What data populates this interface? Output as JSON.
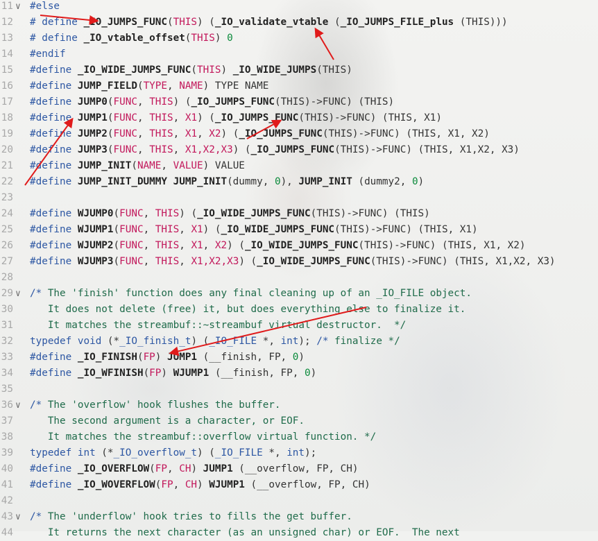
{
  "editor": {
    "lines": [
      {
        "n": "11",
        "fold": true,
        "tokens": [
          {
            "t": "k",
            "v": "#else"
          }
        ]
      },
      {
        "n": "12",
        "tokens": [
          {
            "t": "k",
            "v": "# define "
          },
          {
            "t": "b",
            "v": "_IO_JUMPS_FUNC"
          },
          {
            "t": "p",
            "v": "("
          },
          {
            "t": "s",
            "v": "THIS"
          },
          {
            "t": "p",
            "v": ") ("
          },
          {
            "t": "b",
            "v": "_IO_validate_vtable"
          },
          {
            "t": "p",
            "v": " ("
          },
          {
            "t": "b",
            "v": "_IO_JUMPS_FILE_plus"
          },
          {
            "t": "p",
            "v": " (THIS)))"
          }
        ]
      },
      {
        "n": "13",
        "tokens": [
          {
            "t": "k",
            "v": "# define "
          },
          {
            "t": "b",
            "v": "_IO_vtable_offset"
          },
          {
            "t": "p",
            "v": "("
          },
          {
            "t": "s",
            "v": "THIS"
          },
          {
            "t": "p",
            "v": ") "
          },
          {
            "t": "n",
            "v": "0"
          }
        ]
      },
      {
        "n": "14",
        "tokens": [
          {
            "t": "k",
            "v": "#endif"
          }
        ]
      },
      {
        "n": "15",
        "tokens": [
          {
            "t": "k",
            "v": "#define "
          },
          {
            "t": "b",
            "v": "_IO_WIDE_JUMPS_FUNC"
          },
          {
            "t": "p",
            "v": "("
          },
          {
            "t": "s",
            "v": "THIS"
          },
          {
            "t": "p",
            "v": ") "
          },
          {
            "t": "b",
            "v": "_IO_WIDE_JUMPS"
          },
          {
            "t": "p",
            "v": "(THIS)"
          }
        ]
      },
      {
        "n": "16",
        "tokens": [
          {
            "t": "k",
            "v": "#define "
          },
          {
            "t": "b",
            "v": "JUMP_FIELD"
          },
          {
            "t": "p",
            "v": "("
          },
          {
            "t": "s",
            "v": "TYPE"
          },
          {
            "t": "p",
            "v": ", "
          },
          {
            "t": "s",
            "v": "NAME"
          },
          {
            "t": "p",
            "v": ") TYPE NAME"
          }
        ]
      },
      {
        "n": "17",
        "tokens": [
          {
            "t": "k",
            "v": "#define "
          },
          {
            "t": "b",
            "v": "JUMP0"
          },
          {
            "t": "p",
            "v": "("
          },
          {
            "t": "s",
            "v": "FUNC"
          },
          {
            "t": "p",
            "v": ", "
          },
          {
            "t": "s",
            "v": "THIS"
          },
          {
            "t": "p",
            "v": ") ("
          },
          {
            "t": "b",
            "v": "_IO_JUMPS_FUNC"
          },
          {
            "t": "p",
            "v": "(THIS)->FUNC) (THIS)"
          }
        ]
      },
      {
        "n": "18",
        "tokens": [
          {
            "t": "k",
            "v": "#define "
          },
          {
            "t": "b",
            "v": "JUMP1"
          },
          {
            "t": "p",
            "v": "("
          },
          {
            "t": "s",
            "v": "FUNC"
          },
          {
            "t": "p",
            "v": ", "
          },
          {
            "t": "s",
            "v": "THIS"
          },
          {
            "t": "p",
            "v": ", "
          },
          {
            "t": "s",
            "v": "X1"
          },
          {
            "t": "p",
            "v": ") ("
          },
          {
            "t": "b",
            "v": "_IO_JUMPS_FUNC"
          },
          {
            "t": "p",
            "v": "(THIS)->FUNC) (THIS, X1)"
          }
        ]
      },
      {
        "n": "19",
        "tokens": [
          {
            "t": "k",
            "v": "#define "
          },
          {
            "t": "b",
            "v": "JUMP2"
          },
          {
            "t": "p",
            "v": "("
          },
          {
            "t": "s",
            "v": "FUNC"
          },
          {
            "t": "p",
            "v": ", "
          },
          {
            "t": "s",
            "v": "THIS"
          },
          {
            "t": "p",
            "v": ", "
          },
          {
            "t": "s",
            "v": "X1"
          },
          {
            "t": "p",
            "v": ", "
          },
          {
            "t": "s",
            "v": "X2"
          },
          {
            "t": "p",
            "v": ") ("
          },
          {
            "t": "b",
            "v": "_IO_JUMPS_FUNC"
          },
          {
            "t": "p",
            "v": "(THIS)->FUNC) (THIS, X1, X2)"
          }
        ]
      },
      {
        "n": "20",
        "tokens": [
          {
            "t": "k",
            "v": "#define "
          },
          {
            "t": "b",
            "v": "JUMP3"
          },
          {
            "t": "p",
            "v": "("
          },
          {
            "t": "s",
            "v": "FUNC"
          },
          {
            "t": "p",
            "v": ", "
          },
          {
            "t": "s",
            "v": "THIS"
          },
          {
            "t": "p",
            "v": ", "
          },
          {
            "t": "s",
            "v": "X1,X2,X3"
          },
          {
            "t": "p",
            "v": ") ("
          },
          {
            "t": "b",
            "v": "_IO_JUMPS_FUNC"
          },
          {
            "t": "p",
            "v": "(THIS)->FUNC) (THIS, X1,X2, X3)"
          }
        ]
      },
      {
        "n": "21",
        "tokens": [
          {
            "t": "k",
            "v": "#define "
          },
          {
            "t": "b",
            "v": "JUMP_INIT"
          },
          {
            "t": "p",
            "v": "("
          },
          {
            "t": "s",
            "v": "NAME"
          },
          {
            "t": "p",
            "v": ", "
          },
          {
            "t": "s",
            "v": "VALUE"
          },
          {
            "t": "p",
            "v": ") VALUE"
          }
        ]
      },
      {
        "n": "22",
        "tokens": [
          {
            "t": "k",
            "v": "#define "
          },
          {
            "t": "b",
            "v": "JUMP_INIT_DUMMY"
          },
          {
            "t": "p",
            "v": " "
          },
          {
            "t": "b",
            "v": "JUMP_INIT"
          },
          {
            "t": "p",
            "v": "(dummy, "
          },
          {
            "t": "n",
            "v": "0"
          },
          {
            "t": "p",
            "v": "), "
          },
          {
            "t": "b",
            "v": "JUMP_INIT"
          },
          {
            "t": "p",
            "v": " (dummy2, "
          },
          {
            "t": "n",
            "v": "0"
          },
          {
            "t": "p",
            "v": ")"
          }
        ]
      },
      {
        "n": "23",
        "tokens": []
      },
      {
        "n": "24",
        "tokens": [
          {
            "t": "k",
            "v": "#define "
          },
          {
            "t": "b",
            "v": "WJUMP0"
          },
          {
            "t": "p",
            "v": "("
          },
          {
            "t": "s",
            "v": "FUNC"
          },
          {
            "t": "p",
            "v": ", "
          },
          {
            "t": "s",
            "v": "THIS"
          },
          {
            "t": "p",
            "v": ") ("
          },
          {
            "t": "b",
            "v": "_IO_WIDE_JUMPS_FUNC"
          },
          {
            "t": "p",
            "v": "(THIS)->FUNC) (THIS)"
          }
        ]
      },
      {
        "n": "25",
        "tokens": [
          {
            "t": "k",
            "v": "#define "
          },
          {
            "t": "b",
            "v": "WJUMP1"
          },
          {
            "t": "p",
            "v": "("
          },
          {
            "t": "s",
            "v": "FUNC"
          },
          {
            "t": "p",
            "v": ", "
          },
          {
            "t": "s",
            "v": "THIS"
          },
          {
            "t": "p",
            "v": ", "
          },
          {
            "t": "s",
            "v": "X1"
          },
          {
            "t": "p",
            "v": ") ("
          },
          {
            "t": "b",
            "v": "_IO_WIDE_JUMPS_FUNC"
          },
          {
            "t": "p",
            "v": "(THIS)->FUNC) (THIS, X1)"
          }
        ]
      },
      {
        "n": "26",
        "tokens": [
          {
            "t": "k",
            "v": "#define "
          },
          {
            "t": "b",
            "v": "WJUMP2"
          },
          {
            "t": "p",
            "v": "("
          },
          {
            "t": "s",
            "v": "FUNC"
          },
          {
            "t": "p",
            "v": ", "
          },
          {
            "t": "s",
            "v": "THIS"
          },
          {
            "t": "p",
            "v": ", "
          },
          {
            "t": "s",
            "v": "X1"
          },
          {
            "t": "p",
            "v": ", "
          },
          {
            "t": "s",
            "v": "X2"
          },
          {
            "t": "p",
            "v": ") ("
          },
          {
            "t": "b",
            "v": "_IO_WIDE_JUMPS_FUNC"
          },
          {
            "t": "p",
            "v": "(THIS)->FUNC) (THIS, X1, X2)"
          }
        ]
      },
      {
        "n": "27",
        "tokens": [
          {
            "t": "k",
            "v": "#define "
          },
          {
            "t": "b",
            "v": "WJUMP3"
          },
          {
            "t": "p",
            "v": "("
          },
          {
            "t": "s",
            "v": "FUNC"
          },
          {
            "t": "p",
            "v": ", "
          },
          {
            "t": "s",
            "v": "THIS"
          },
          {
            "t": "p",
            "v": ", "
          },
          {
            "t": "s",
            "v": "X1,X2,X3"
          },
          {
            "t": "p",
            "v": ") ("
          },
          {
            "t": "b",
            "v": "_IO_WIDE_JUMPS_FUNC"
          },
          {
            "t": "p",
            "v": "(THIS)->FUNC) (THIS, X1,X2, X3)"
          }
        ]
      },
      {
        "n": "28",
        "tokens": []
      },
      {
        "n": "29",
        "fold": true,
        "tokens": [
          {
            "t": "k",
            "v": "/* "
          },
          {
            "t": "c",
            "v": "The 'finish' function does any final cleaning up of an _IO_FILE object."
          }
        ]
      },
      {
        "n": "30",
        "tokens": [
          {
            "t": "c",
            "v": "   It does not delete (free) it, but does everything else to finalize it."
          }
        ]
      },
      {
        "n": "31",
        "tokens": [
          {
            "t": "c",
            "v": "   It matches the streambuf::~streambuf virtual destructor.  */"
          }
        ]
      },
      {
        "n": "32",
        "tokens": [
          {
            "t": "k",
            "v": "typedef"
          },
          {
            "t": "p",
            "v": " "
          },
          {
            "t": "k",
            "v": "void"
          },
          {
            "t": "p",
            "v": " (*"
          },
          {
            "t": "k",
            "v": "_IO_finish_t"
          },
          {
            "t": "p",
            "v": ") ("
          },
          {
            "t": "k",
            "v": "_IO_FILE"
          },
          {
            "t": "p",
            "v": " *, "
          },
          {
            "t": "k",
            "v": "int"
          },
          {
            "t": "p",
            "v": "); "
          },
          {
            "t": "k",
            "v": "/* "
          },
          {
            "t": "c",
            "v": "finalize */"
          }
        ]
      },
      {
        "n": "33",
        "tokens": [
          {
            "t": "k",
            "v": "#define "
          },
          {
            "t": "b",
            "v": "_IO_FINISH"
          },
          {
            "t": "p",
            "v": "("
          },
          {
            "t": "s",
            "v": "FP"
          },
          {
            "t": "p",
            "v": ") "
          },
          {
            "t": "b",
            "v": "JUMP1"
          },
          {
            "t": "p",
            "v": " (__finish, FP, "
          },
          {
            "t": "n",
            "v": "0"
          },
          {
            "t": "p",
            "v": ")"
          }
        ]
      },
      {
        "n": "34",
        "tokens": [
          {
            "t": "k",
            "v": "#define "
          },
          {
            "t": "b",
            "v": "_IO_WFINISH"
          },
          {
            "t": "p",
            "v": "("
          },
          {
            "t": "s",
            "v": "FP"
          },
          {
            "t": "p",
            "v": ") "
          },
          {
            "t": "b",
            "v": "WJUMP1"
          },
          {
            "t": "p",
            "v": " (__finish, FP, "
          },
          {
            "t": "n",
            "v": "0"
          },
          {
            "t": "p",
            "v": ")"
          }
        ]
      },
      {
        "n": "35",
        "tokens": []
      },
      {
        "n": "36",
        "fold": true,
        "tokens": [
          {
            "t": "k",
            "v": "/* "
          },
          {
            "t": "c",
            "v": "The 'overflow' hook flushes the buffer."
          }
        ]
      },
      {
        "n": "37",
        "tokens": [
          {
            "t": "c",
            "v": "   The second argument is a character, or EOF."
          }
        ]
      },
      {
        "n": "38",
        "tokens": [
          {
            "t": "c",
            "v": "   It matches the streambuf::overflow virtual function. */"
          }
        ]
      },
      {
        "n": "39",
        "tokens": [
          {
            "t": "k",
            "v": "typedef"
          },
          {
            "t": "p",
            "v": " "
          },
          {
            "t": "k",
            "v": "int"
          },
          {
            "t": "p",
            "v": " (*"
          },
          {
            "t": "k",
            "v": "_IO_overflow_t"
          },
          {
            "t": "p",
            "v": ") ("
          },
          {
            "t": "k",
            "v": "_IO_FILE"
          },
          {
            "t": "p",
            "v": " *, "
          },
          {
            "t": "k",
            "v": "int"
          },
          {
            "t": "p",
            "v": ");"
          }
        ]
      },
      {
        "n": "40",
        "tokens": [
          {
            "t": "k",
            "v": "#define "
          },
          {
            "t": "b",
            "v": "_IO_OVERFLOW"
          },
          {
            "t": "p",
            "v": "("
          },
          {
            "t": "s",
            "v": "FP"
          },
          {
            "t": "p",
            "v": ", "
          },
          {
            "t": "s",
            "v": "CH"
          },
          {
            "t": "p",
            "v": ") "
          },
          {
            "t": "b",
            "v": "JUMP1"
          },
          {
            "t": "p",
            "v": " (__overflow, FP, CH)"
          }
        ]
      },
      {
        "n": "41",
        "tokens": [
          {
            "t": "k",
            "v": "#define "
          },
          {
            "t": "b",
            "v": "_IO_WOVERFLOW"
          },
          {
            "t": "p",
            "v": "("
          },
          {
            "t": "s",
            "v": "FP"
          },
          {
            "t": "p",
            "v": ", "
          },
          {
            "t": "s",
            "v": "CH"
          },
          {
            "t": "p",
            "v": ") "
          },
          {
            "t": "b",
            "v": "WJUMP1"
          },
          {
            "t": "p",
            "v": " (__overflow, FP, CH)"
          }
        ]
      },
      {
        "n": "42",
        "tokens": []
      },
      {
        "n": "43",
        "fold": true,
        "tokens": [
          {
            "t": "k",
            "v": "/* "
          },
          {
            "t": "c",
            "v": "The 'underflow' hook tries to fills the get buffer."
          }
        ]
      },
      {
        "n": "44",
        "tokens": [
          {
            "t": "c",
            "v": "   It returns the next character (as an unsigned char) or EOF.  The next"
          }
        ]
      }
    ]
  },
  "colors": {
    "keyword": "#2d57a3",
    "param": "#c2185b",
    "comment": "#1f6b4a",
    "number": "#0a8a3b",
    "annotation_arrow": "#e01b1b"
  },
  "icons": {
    "fold": "chevron-down-icon"
  },
  "fold_glyph": "∨"
}
